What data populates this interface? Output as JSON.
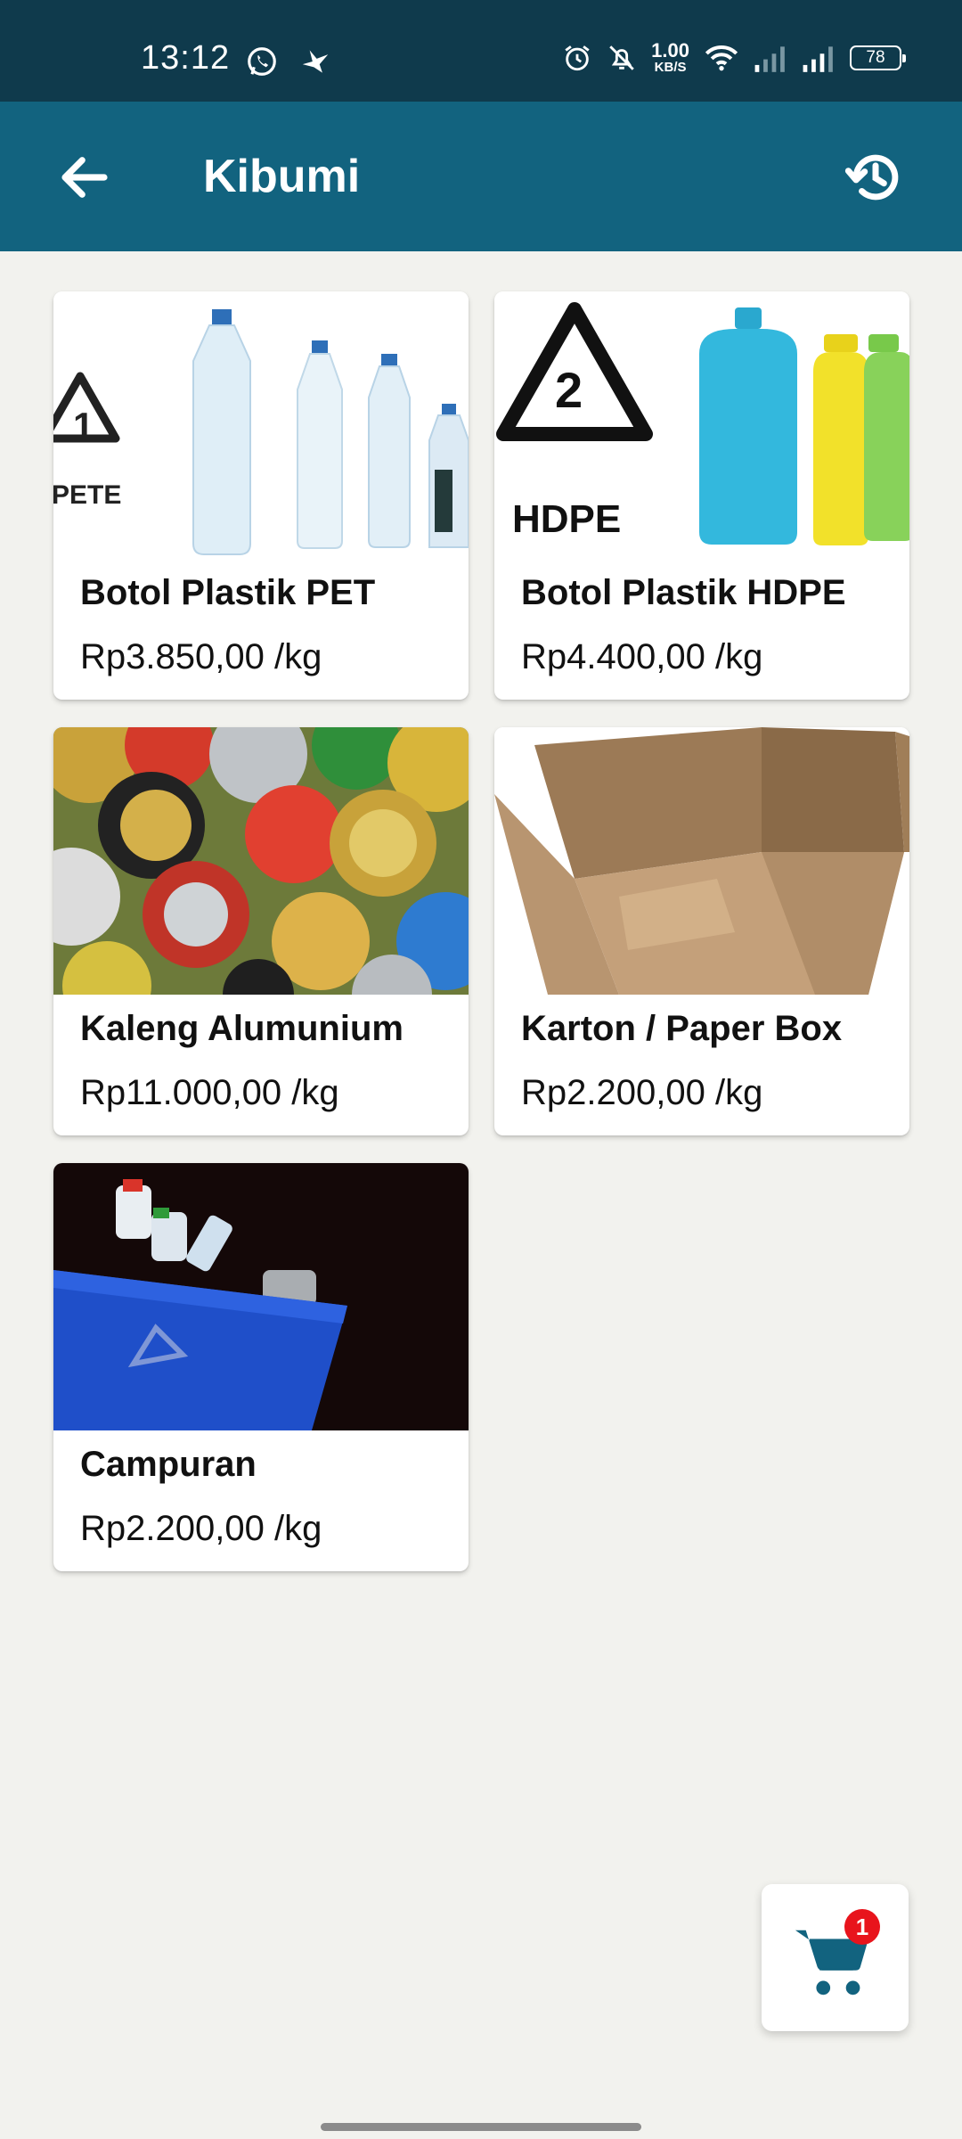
{
  "status_bar": {
    "time": "13:12",
    "speed_value": "1.00",
    "speed_unit": "KB/S",
    "battery": "78",
    "icons": [
      "whatsapp-icon",
      "bird-icon",
      "alarm-icon",
      "bell-off-icon",
      "wifi-icon",
      "signal-icon"
    ]
  },
  "app_bar": {
    "title": "Kibumi",
    "back_icon": "arrow-left-icon",
    "history_icon": "history-icon"
  },
  "products": [
    {
      "name": "Botol Plastik PET",
      "price": "Rp3.850,00 /kg"
    },
    {
      "name": "Botol Plastik HDPE",
      "price": "Rp4.400,00 /kg"
    },
    {
      "name": "Kaleng Alumunium",
      "price": "Rp11.000,00 /kg"
    },
    {
      "name": "Karton / Paper Box",
      "price": "Rp2.200,00 /kg"
    },
    {
      "name": "Campuran",
      "price": "Rp2.200,00 /kg"
    }
  ],
  "image_text": {
    "pet_code": "1",
    "pet_label": "PETE",
    "hdpe_code": "2",
    "hdpe_label": "HDPE"
  },
  "cart": {
    "badge_count": "1",
    "icon": "shopping-cart-icon"
  },
  "colors": {
    "status_bar": "#0f3a4c",
    "app_bar": "#12637f",
    "background": "#f2f2ee",
    "badge": "#e8141c"
  }
}
